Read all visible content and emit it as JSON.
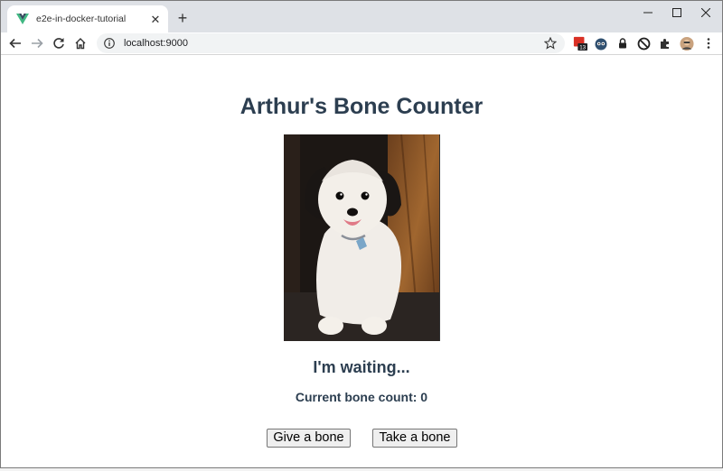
{
  "browser": {
    "tab_title": "e2e-in-docker-tutorial",
    "url": "localhost:9000",
    "extension_badge": "13"
  },
  "page": {
    "title": "Arthur's Bone Counter",
    "status": "I'm waiting...",
    "count_label": "Current bone count: 0",
    "give_button": "Give a bone",
    "take_button": "Take a bone"
  },
  "colors": {
    "heading": "#2c3e50",
    "tab_strip": "#dee1e6",
    "omnibox": "#f1f3f4"
  }
}
